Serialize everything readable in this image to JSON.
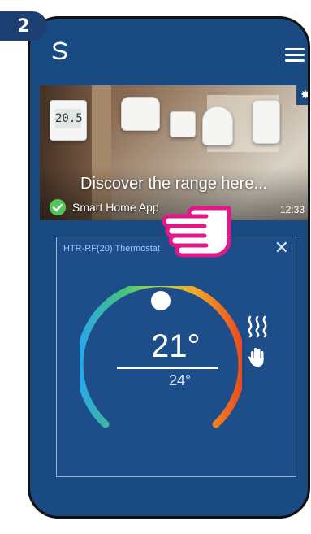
{
  "step": {
    "number": "2"
  },
  "colors": {
    "phone_bg": "#1a4a82",
    "card_bg": "#1d4e89",
    "badge_bg": "#1e3f74",
    "check": "#52c65a"
  },
  "header": {
    "logo_icon": "salus-s-logo-icon",
    "menu_icon": "hamburger-menu-icon"
  },
  "banner": {
    "lcd_value": "20.5",
    "title": "Discover the range here...",
    "app_name": "Smart Home App",
    "time": "12:33",
    "settings_icon": "gear-icon"
  },
  "thermostat": {
    "title": "HTR-RF(20) Thermostat",
    "current_temp": "21°",
    "set_temp": "24°",
    "mode_icons": [
      "heating-icon",
      "manual-mode-hand-icon"
    ]
  }
}
